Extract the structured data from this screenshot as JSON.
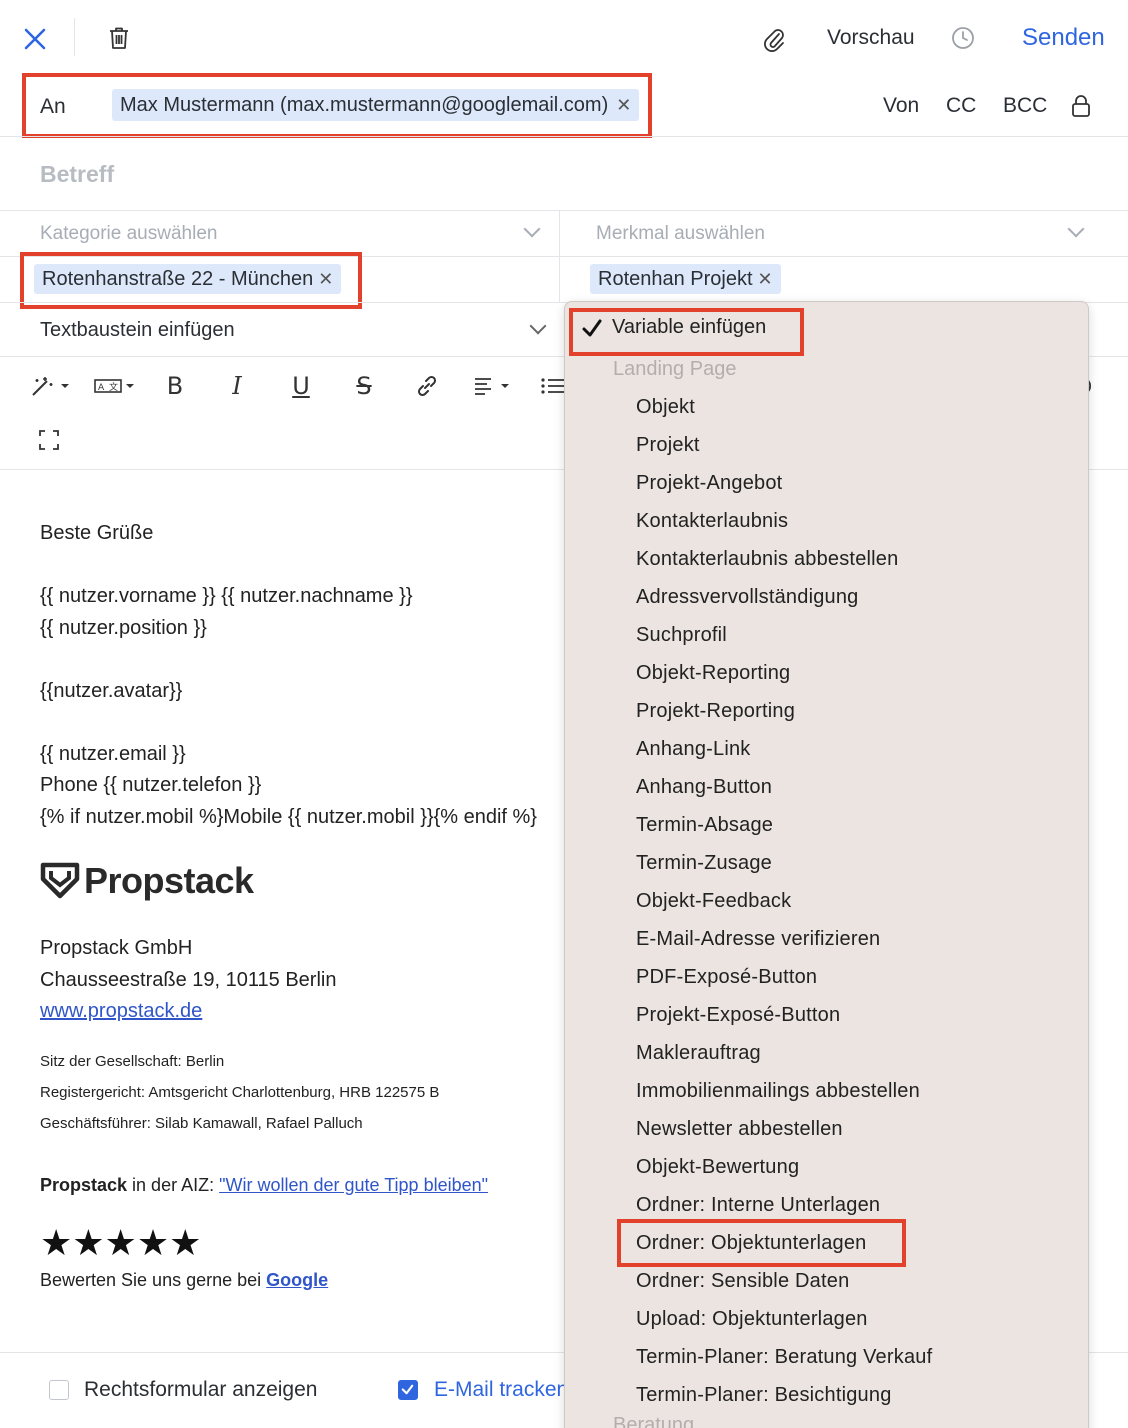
{
  "toolbar": {
    "preview_label": "Vorschau",
    "send_label": "Senden"
  },
  "recipient": {
    "label": "An",
    "chip": "Max Mustermann (max.mustermann@googlemail.com)",
    "von": "Von",
    "cc": "CC",
    "bcc": "BCC"
  },
  "subject": {
    "placeholder": "Betreff"
  },
  "category": {
    "placeholder": "Kategorie auswählen",
    "chip": "Rotenhanstraße 22 - München"
  },
  "feature": {
    "placeholder": "Merkmal auswählen",
    "chip": "Rotenhan Projekt"
  },
  "snippet": {
    "label": "Textbaustein einfügen"
  },
  "formatting": {
    "bold": "B",
    "italic": "I",
    "underline": "U",
    "strike": "S"
  },
  "body": {
    "greeting": "Beste Grüße",
    "line_name": "{{ nutzer.vorname }} {{ nutzer.nachname }}",
    "line_position": "{{ nutzer.position }}",
    "line_avatar": "{{nutzer.avatar}}",
    "line_email": "{{ nutzer.email }}",
    "line_phone": "Phone {{ nutzer.telefon }}",
    "line_mobile": "{% if nutzer.mobil %}Mobile {{ nutzer.mobil }}{% endif %}",
    "logo_text": "Propstack",
    "company": "Propstack GmbH",
    "address": "Chausseestraße 19, 10115 Berlin",
    "website": "www.propstack.de",
    "seat": "Sitz der Gesellschaft: Berlin",
    "register": "Registergericht: Amtsgericht Charlottenburg, HRB 122575 B",
    "managers": "Geschäftsführer: Silab Kamawall, Rafael Palluch",
    "aiz_brand": "Propstack",
    "aiz_text": " in der AIZ: ",
    "aiz_link": "\"Wir wollen der gute Tipp bleiben\"",
    "stars": "★★★★★",
    "rating": 5,
    "review_text": "Bewerten Sie uns gerne bei ",
    "review_link": "Google"
  },
  "dropdown": {
    "header": "Variable einfügen",
    "group": "Landing Page",
    "items": [
      "Objekt",
      "Projekt",
      "Projekt-Angebot",
      "Kontakterlaubnis",
      "Kontakterlaubnis abbestellen",
      "Adressvervollständigung",
      "Suchprofil",
      "Objekt-Reporting",
      "Projekt-Reporting",
      "Anhang-Link",
      "Anhang-Button",
      "Termin-Absage",
      "Termin-Zusage",
      "Objekt-Feedback",
      "E-Mail-Adresse verifizieren",
      "PDF-Exposé-Button",
      "Projekt-Exposé-Button",
      "Maklerauftrag",
      "Immobilienmailings abbestellen",
      "Newsletter abbestellen",
      "Objekt-Bewertung",
      "Ordner: Interne Unterlagen",
      "Ordner: Objektunterlagen",
      "Ordner: Sensible Daten",
      "Upload: Objektunterlagen",
      "Termin-Planer: Beratung Verkauf",
      "Termin-Planer: Besichtigung"
    ],
    "next_group_partial": "Beratung"
  },
  "footer": {
    "legal_form_label": "Rechtsformular anzeigen",
    "legal_form_checked": false,
    "tracking_label": "E-Mail tracken",
    "tracking_checked": true
  },
  "colors": {
    "accent": "#2f66e0",
    "highlight_box": "#e2412c",
    "chip_bg": "#dde9fb",
    "dropdown_bg": "#ebe4e1"
  }
}
